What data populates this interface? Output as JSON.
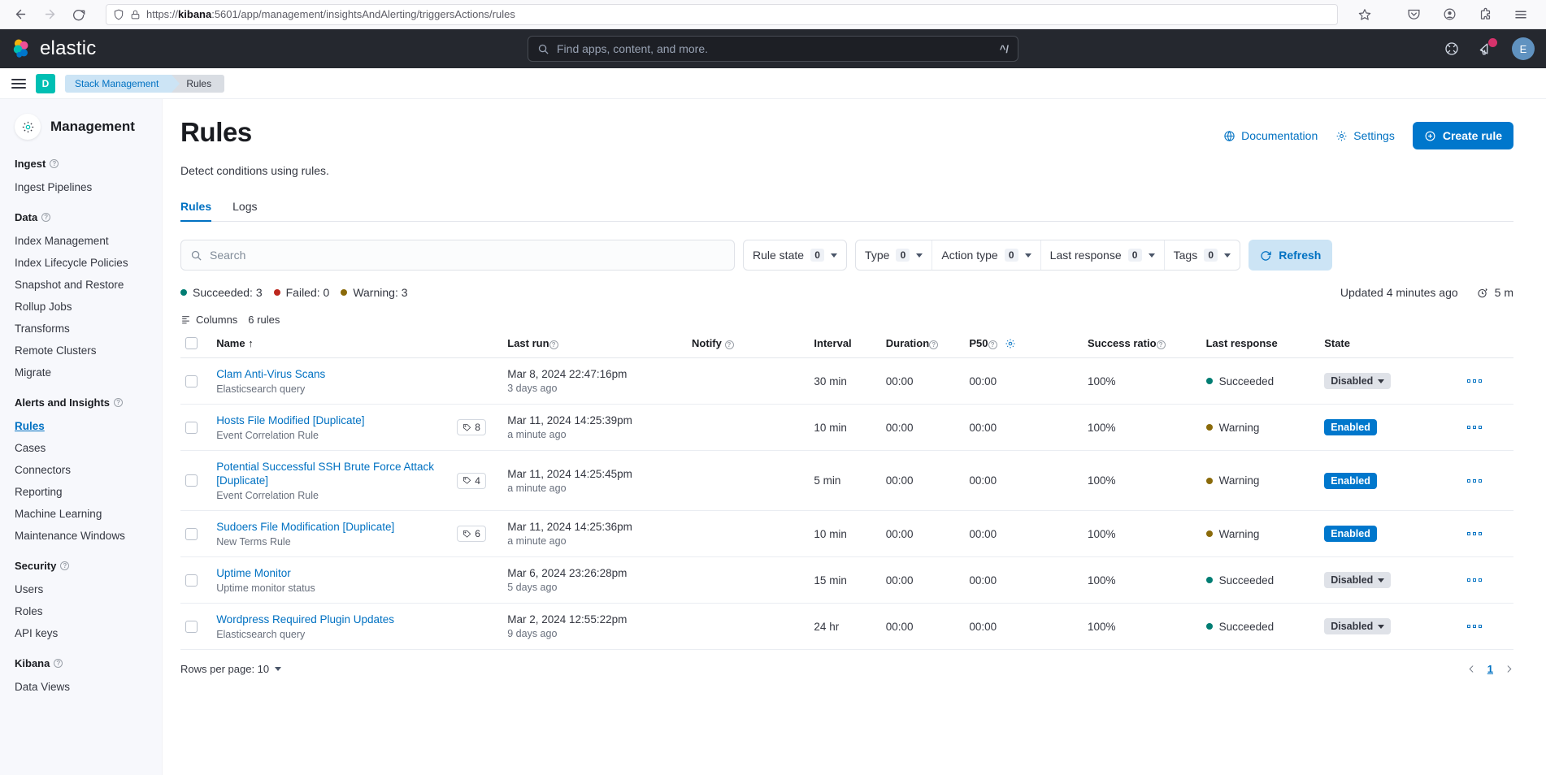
{
  "browser": {
    "url_prefix": "https://",
    "url_host": "kibana",
    "url_rest": ":5601/app/management/insightsAndAlerting/triggersActions/rules",
    "back_icon": "back-arrow-icon",
    "forward_icon": "forward-arrow-icon",
    "reload_icon": "reload-icon"
  },
  "topnav": {
    "brand": "elastic",
    "search_placeholder": "Find apps, content, and more.",
    "search_shortcut": "^/",
    "avatar_initial": "E"
  },
  "breadcrumb": {
    "space_initial": "D",
    "items": [
      {
        "label": "Stack Management"
      },
      {
        "label": "Rules"
      }
    ]
  },
  "sidebar": {
    "title": "Management",
    "groups": [
      {
        "title": "Ingest",
        "items": [
          {
            "label": "Ingest Pipelines",
            "active": false
          }
        ]
      },
      {
        "title": "Data",
        "items": [
          {
            "label": "Index Management",
            "active": false
          },
          {
            "label": "Index Lifecycle Policies",
            "active": false
          },
          {
            "label": "Snapshot and Restore",
            "active": false
          },
          {
            "label": "Rollup Jobs",
            "active": false
          },
          {
            "label": "Transforms",
            "active": false
          },
          {
            "label": "Remote Clusters",
            "active": false
          },
          {
            "label": "Migrate",
            "active": false
          }
        ]
      },
      {
        "title": "Alerts and Insights",
        "items": [
          {
            "label": "Rules",
            "active": true
          },
          {
            "label": "Cases",
            "active": false
          },
          {
            "label": "Connectors",
            "active": false
          },
          {
            "label": "Reporting",
            "active": false
          },
          {
            "label": "Machine Learning",
            "active": false
          },
          {
            "label": "Maintenance Windows",
            "active": false
          }
        ]
      },
      {
        "title": "Security",
        "items": [
          {
            "label": "Users",
            "active": false
          },
          {
            "label": "Roles",
            "active": false
          },
          {
            "label": "API keys",
            "active": false
          }
        ]
      },
      {
        "title": "Kibana",
        "items": [
          {
            "label": "Data Views",
            "active": false
          }
        ]
      }
    ]
  },
  "header": {
    "title": "Rules",
    "subtitle": "Detect conditions using rules.",
    "documentation_label": "Documentation",
    "settings_label": "Settings",
    "create_label": "Create rule"
  },
  "tabs": [
    {
      "label": "Rules",
      "active": true
    },
    {
      "label": "Logs",
      "active": false
    }
  ],
  "filters": {
    "search_placeholder": "Search",
    "rule_state": {
      "label": "Rule state",
      "count": "0"
    },
    "type": {
      "label": "Type",
      "count": "0"
    },
    "action_type": {
      "label": "Action type",
      "count": "0"
    },
    "last_response": {
      "label": "Last response",
      "count": "0"
    },
    "tags": {
      "label": "Tags",
      "count": "0"
    },
    "refresh_label": "Refresh"
  },
  "status": {
    "succeeded": "Succeeded: 3",
    "failed": "Failed: 0",
    "warning": "Warning: 3",
    "updated_text": "Updated 4 minutes ago",
    "interval": "5 m"
  },
  "table_tools": {
    "columns_label": "Columns",
    "rule_count_label": "6 rules"
  },
  "table": {
    "columns": [
      {
        "key": "name",
        "label": "Name",
        "sorted": true,
        "sort_glyph": "↑",
        "info": false
      },
      {
        "key": "last_run",
        "label": "Last run",
        "info": true
      },
      {
        "key": "notify",
        "label": "Notify",
        "info": true
      },
      {
        "key": "interval",
        "label": "Interval",
        "info": false
      },
      {
        "key": "duration",
        "label": "Duration",
        "info": true
      },
      {
        "key": "p50",
        "label": "P50",
        "info": true,
        "gear": true
      },
      {
        "key": "success_ratio",
        "label": "Success ratio",
        "info": true
      },
      {
        "key": "last_response",
        "label": "Last response",
        "info": false
      },
      {
        "key": "state",
        "label": "State",
        "info": false
      }
    ],
    "rows": [
      {
        "name": "Clam Anti-Virus Scans",
        "type": "Elasticsearch query",
        "tags": "",
        "last_run": "Mar 8, 2024 22:47:16pm",
        "last_run_rel": "3 days ago",
        "notify": "",
        "interval": "30 min",
        "duration": "00:00",
        "p50": "00:00",
        "success_ratio": "100%",
        "last_response": "Succeeded",
        "last_response_color": "#017d73",
        "state": "Disabled",
        "state_kind": "disabled"
      },
      {
        "name": "Hosts File Modified [Duplicate]",
        "type": "Event Correlation Rule",
        "tags": "8",
        "last_run": "Mar 11, 2024 14:25:39pm",
        "last_run_rel": "a minute ago",
        "notify": "",
        "interval": "10 min",
        "duration": "00:00",
        "p50": "00:00",
        "success_ratio": "100%",
        "last_response": "Warning",
        "last_response_color": "#8a6a0a",
        "state": "Enabled",
        "state_kind": "enabled"
      },
      {
        "name": "Potential Successful SSH Brute Force Attack [Duplicate]",
        "type": "Event Correlation Rule",
        "tags": "4",
        "last_run": "Mar 11, 2024 14:25:45pm",
        "last_run_rel": "a minute ago",
        "notify": "",
        "interval": "5 min",
        "duration": "00:00",
        "p50": "00:00",
        "success_ratio": "100%",
        "last_response": "Warning",
        "last_response_color": "#8a6a0a",
        "state": "Enabled",
        "state_kind": "enabled"
      },
      {
        "name": "Sudoers File Modification [Duplicate]",
        "type": "New Terms Rule",
        "tags": "6",
        "last_run": "Mar 11, 2024 14:25:36pm",
        "last_run_rel": "a minute ago",
        "notify": "",
        "interval": "10 min",
        "duration": "00:00",
        "p50": "00:00",
        "success_ratio": "100%",
        "last_response": "Warning",
        "last_response_color": "#8a6a0a",
        "state": "Enabled",
        "state_kind": "enabled"
      },
      {
        "name": "Uptime Monitor",
        "type": "Uptime monitor status",
        "tags": "",
        "last_run": "Mar 6, 2024 23:26:28pm",
        "last_run_rel": "5 days ago",
        "notify": "",
        "interval": "15 min",
        "duration": "00:00",
        "p50": "00:00",
        "success_ratio": "100%",
        "last_response": "Succeeded",
        "last_response_color": "#017d73",
        "state": "Disabled",
        "state_kind": "disabled"
      },
      {
        "name": "Wordpress Required Plugin Updates",
        "type": "Elasticsearch query",
        "tags": "",
        "last_run": "Mar 2, 2024 12:55:22pm",
        "last_run_rel": "9 days ago",
        "notify": "",
        "interval": "24 hr",
        "duration": "00:00",
        "p50": "00:00",
        "success_ratio": "100%",
        "last_response": "Succeeded",
        "last_response_color": "#017d73",
        "state": "Disabled",
        "state_kind": "disabled"
      }
    ]
  },
  "footer": {
    "rows_per_page_label": "Rows per page: 10",
    "page_number": "1"
  },
  "colors": {
    "accent_blue": "#0077cc",
    "link_blue": "#0071c2",
    "teal": "#00bfb3",
    "success": "#017d73",
    "warning": "#8a6a0a",
    "danger": "#bd271e",
    "nav_dark": "#25282f"
  }
}
